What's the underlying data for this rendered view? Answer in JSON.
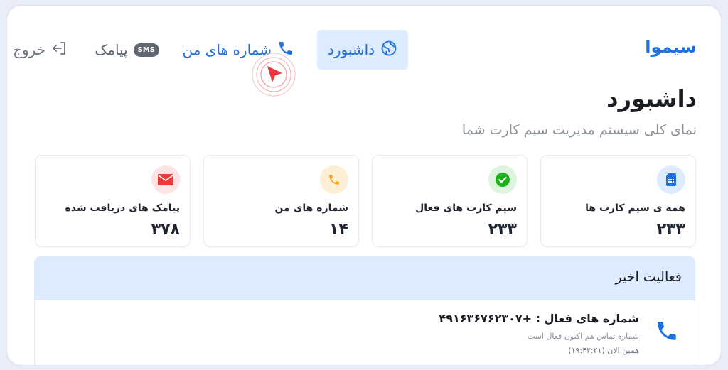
{
  "brand": {
    "name": "سیموا"
  },
  "nav": {
    "items": [
      {
        "label": "داشبورد",
        "icon": "globe-icon",
        "active": true
      },
      {
        "label": "شماره های من",
        "icon": "phone-icon",
        "active": false
      },
      {
        "label": "پیامک",
        "icon": "sms-icon",
        "badge": "SMS",
        "active": false
      },
      {
        "label": "خروج",
        "icon": "logout-icon",
        "active": false
      }
    ]
  },
  "page": {
    "title": "داشبورد",
    "subtitle": "نمای کلی سیستم مدیریت سیم کارت شما"
  },
  "stats": [
    {
      "label": "همه ی سیم کارت ها",
      "value": "۲۳۳",
      "icon": "sim-card-icon",
      "color": "#1e6fe0"
    },
    {
      "label": "سیم کارت های فعال",
      "value": "۲۳۳",
      "icon": "check-circle-icon",
      "color": "#1bb21b"
    },
    {
      "label": "شماره های من",
      "value": "۱۴",
      "icon": "phone-icon",
      "color": "#f2a21c"
    },
    {
      "label": "پیامک های دریافت شده",
      "value": "۳۷۸",
      "icon": "envelope-icon",
      "color": "#e83b3b"
    }
  ],
  "activity": {
    "title": "فعالیت اخیر",
    "items": [
      {
        "title": "شماره های فعال : +۴۹۱۶۳۶۷۶۲۳۰۷",
        "description": "شماره تماس هم اکنون فعال است",
        "time": "همین الان  (۱۹:۴۳:۲۱)",
        "icon": "phone-icon"
      }
    ]
  },
  "colors": {
    "accent": "#1e6fe0",
    "active_nav_bg": "#dcebfd",
    "cursor": "#e8343c"
  }
}
